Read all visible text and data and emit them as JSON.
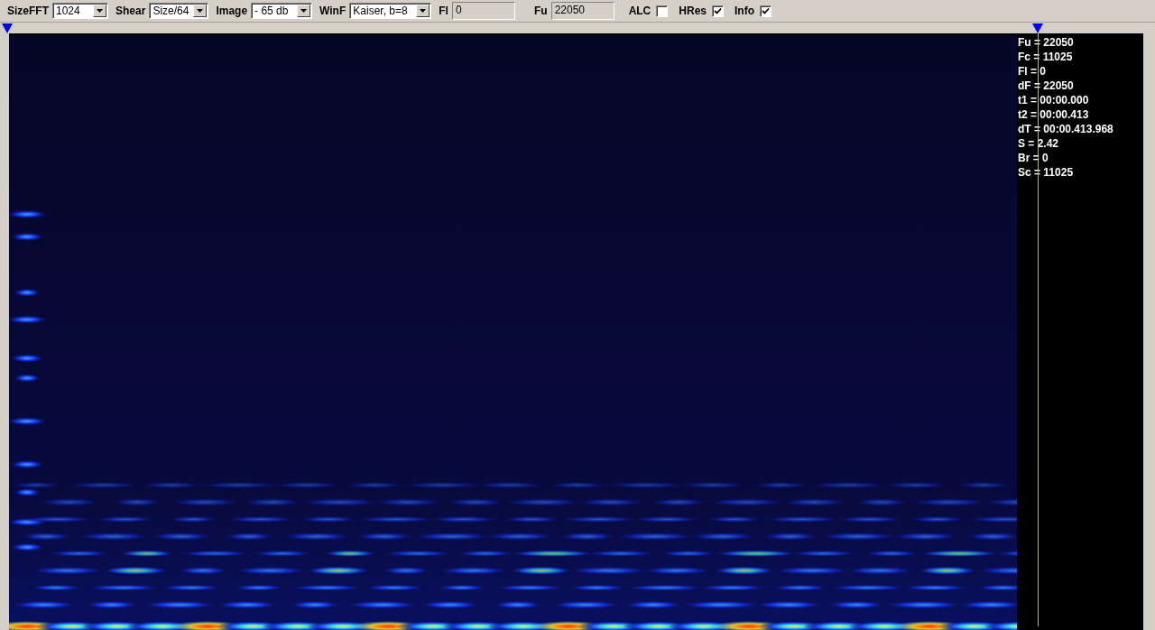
{
  "toolbar": {
    "controls": [
      {
        "kind": "combo",
        "label": "SizeFFT",
        "value": "1024"
      },
      {
        "kind": "combo",
        "label": "Shear",
        "value": "Size/64"
      },
      {
        "kind": "combo",
        "label": "Image",
        "value": "- 65 db"
      },
      {
        "kind": "combo",
        "label": "WinF",
        "value": "Kaiser, b=8"
      },
      {
        "kind": "field",
        "label": "Fl",
        "value": "0"
      },
      {
        "kind": "field",
        "label": "Fu",
        "value": "22050"
      },
      {
        "kind": "checkbox",
        "label": "ALC",
        "checked": false
      },
      {
        "kind": "checkbox",
        "label": "HRes",
        "checked": true
      },
      {
        "kind": "checkbox",
        "label": "Info",
        "checked": true
      }
    ]
  },
  "info_panel": {
    "lines": [
      "Fu = 22050",
      "Fc = 11025",
      "Fl = 0",
      "dF = 22050",
      "t1 = 00:00.000",
      "t2 = 00:00.413",
      "dT = 00:00.413.968",
      "S = 2.42",
      "Br = 0",
      "Sc = 11025"
    ]
  }
}
